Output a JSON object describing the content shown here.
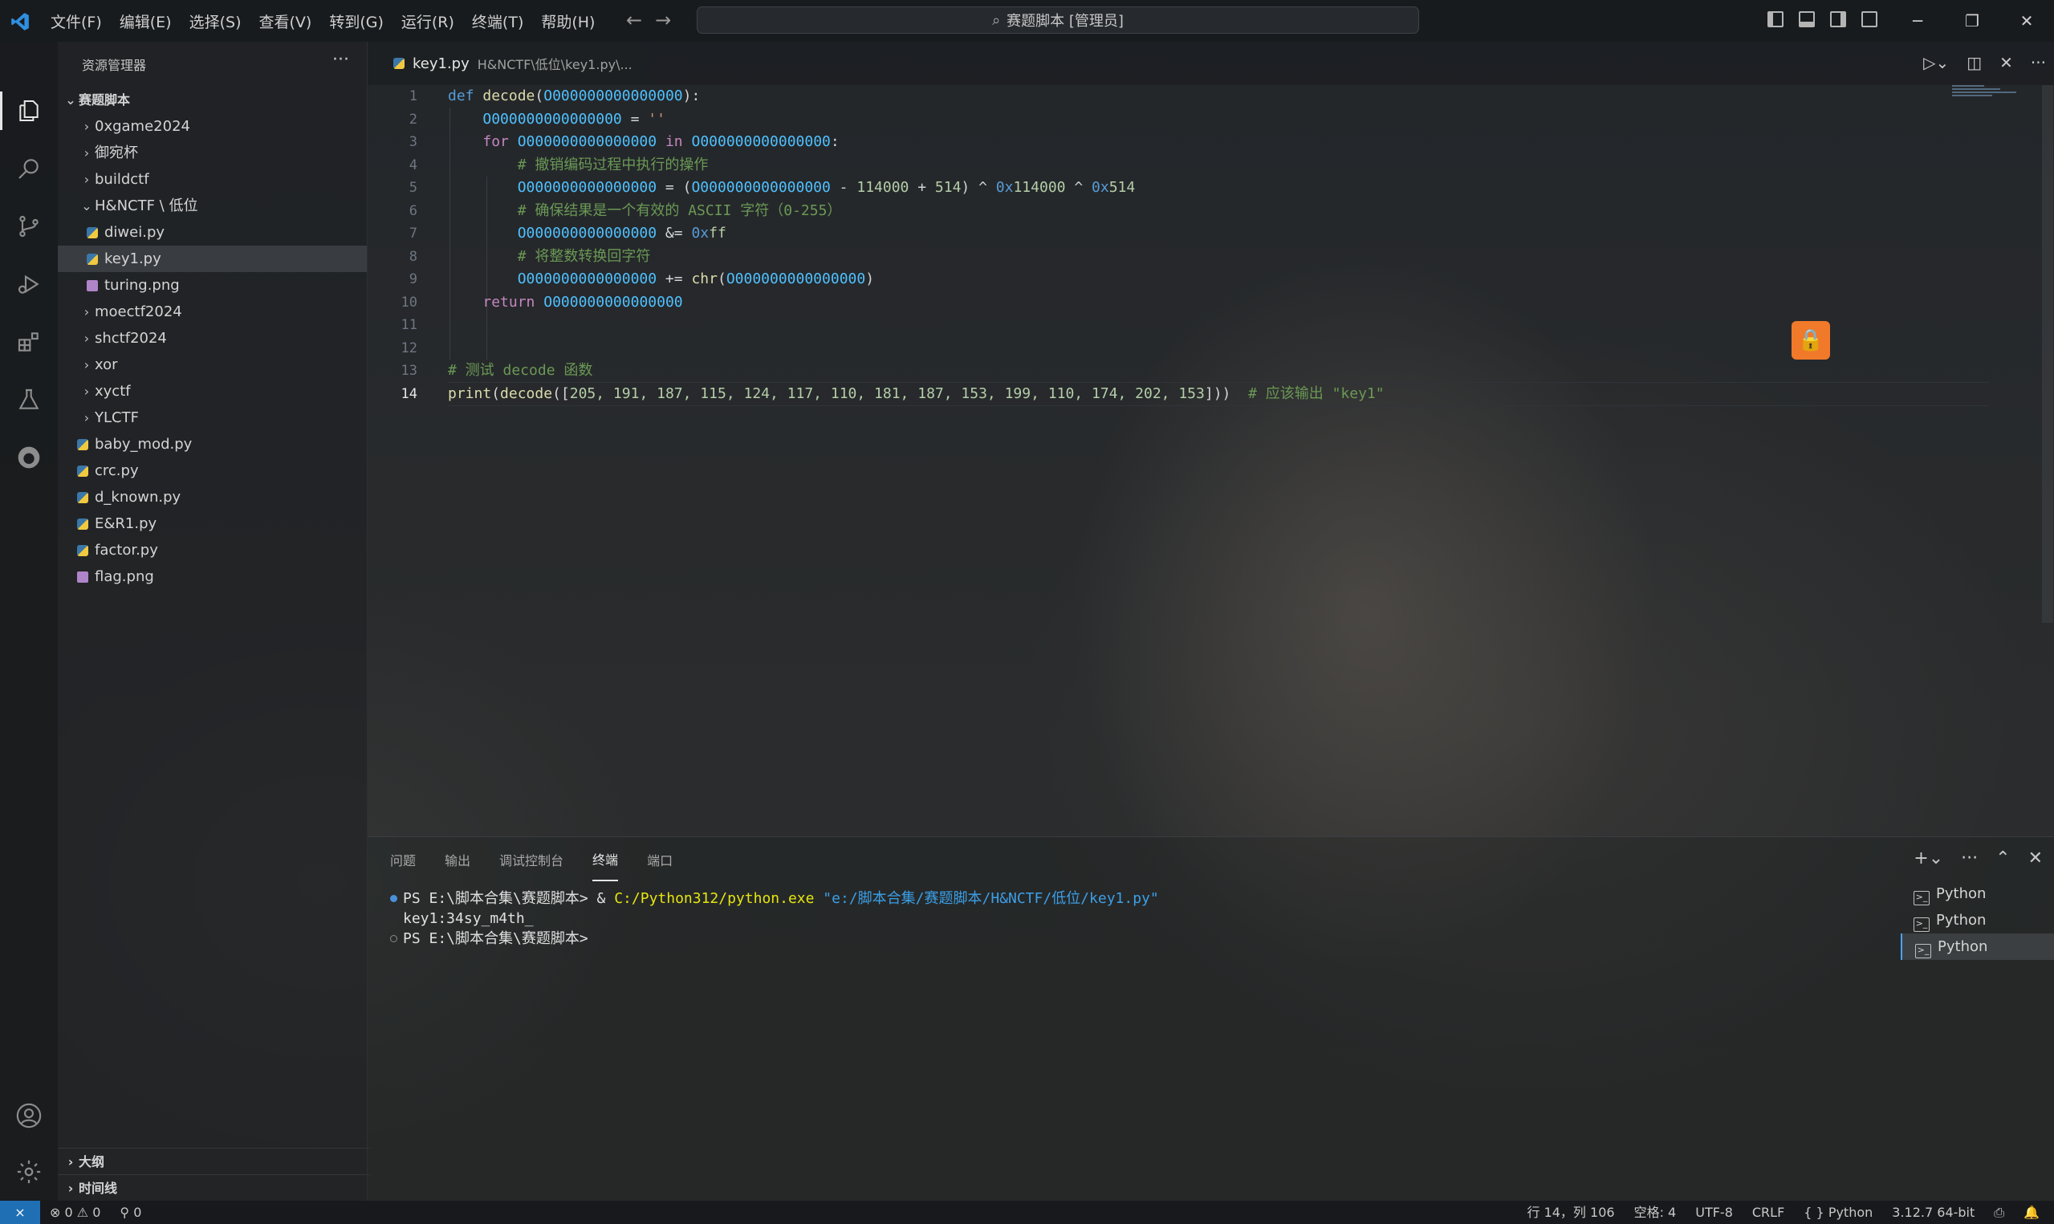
{
  "menu": [
    "文件(F)",
    "编辑(E)",
    "选择(S)",
    "查看(V)",
    "转到(G)",
    "运行(R)",
    "终端(T)",
    "帮助(H)"
  ],
  "command_center": "赛题脚本 [管理员]",
  "sidebar": {
    "title": "资源管理器",
    "root": "赛题脚本",
    "items": [
      {
        "label": "0xgame2024"
      },
      {
        "label": "御宛杯"
      },
      {
        "label": "buildctf"
      },
      {
        "label": "H&NCTF \\ 低位"
      },
      {
        "label": "diwei.py"
      },
      {
        "label": "key1.py"
      },
      {
        "label": "turing.png"
      },
      {
        "label": "moectf2024"
      },
      {
        "label": "shctf2024"
      },
      {
        "label": "xor"
      },
      {
        "label": "xyctf"
      },
      {
        "label": "YLCTF"
      },
      {
        "label": "baby_mod.py"
      },
      {
        "label": "crc.py"
      },
      {
        "label": "d_known.py"
      },
      {
        "label": "E&R1.py"
      },
      {
        "label": "factor.py"
      },
      {
        "label": "flag.png"
      }
    ],
    "outline": "大纲",
    "timeline": "时间线"
  },
  "tab": {
    "name": "key1.py",
    "path": "H&NCTF\\低位\\key1.py\\..."
  },
  "code": {
    "line_numbers": [
      "1",
      "2",
      "3",
      "4",
      "5",
      "6",
      "7",
      "8",
      "9",
      "10",
      "11",
      "12",
      "13",
      "14"
    ],
    "l1": {
      "kw": "def",
      "fn": "decode",
      "arg": "O000000000000000",
      "rest": "):"
    },
    "l2": {
      "var": "O000000000000000",
      "rest": " = ",
      "str": "''"
    },
    "l3": {
      "kw": "for",
      "v1": "O000000000000000",
      "kw2": "in",
      "v2": "O000000000000000",
      "rest": ":"
    },
    "l4": "# 撤销编码过程中执行的操作",
    "l5": {
      "v1": "O000000000000000",
      "v2": "O000000000000000",
      "n1": "114000",
      "n2": "514",
      "h1": "0x",
      "n3": "114000",
      "h2": "0x",
      "n4": "514"
    },
    "l6": "# 确保结果是一个有效的 ASCII 字符（0-255）",
    "l7": {
      "var": "O000000000000000",
      "rest": " &= ",
      "h": "0x",
      "n": "ff"
    },
    "l8": "# 将整数转换回字符",
    "l9": {
      "var": "O000000000000000",
      "rest": " += ",
      "fn": "chr",
      "arg": "O000000000000000"
    },
    "l10": {
      "kw": "return",
      "var": "O000000000000000"
    },
    "l13": "# 测试 decode 函数",
    "l14": {
      "print": "print",
      "fn": "decode",
      "values": "205, 191, 187, 115, 124, 117, 110, 181, 187, 153, 199, 110, 174, 202, 153",
      "comment": "# 应该输出 \"key1\""
    }
  },
  "panel": {
    "tabs": [
      "问题",
      "输出",
      "调试控制台",
      "终端",
      "端口"
    ],
    "terminal": {
      "prompt": "PS E:\\脚本合集\\赛题脚本>",
      "amp": " & ",
      "exe": "C:/Python312/python.exe",
      "arg": " \"e:/脚本合集/赛题脚本/H&NCTF/低位/key1.py\"",
      "output": "key1:34sy_m4th_",
      "prompt2": "PS E:\\脚本合集\\赛题脚本>"
    },
    "terminals": [
      "Python",
      "Python",
      "Python"
    ]
  },
  "statusbar": {
    "errors": "0",
    "warnings": "0",
    "ports": "0",
    "position": "行 14，列 106",
    "spaces": "空格: 4",
    "encoding": "UTF-8",
    "eol": "CRLF",
    "language": "{ } Python",
    "interpreter": "3.12.7 64-bit"
  },
  "colors": {
    "accent": "#1f6fb5",
    "lock": "#f07a2a"
  }
}
